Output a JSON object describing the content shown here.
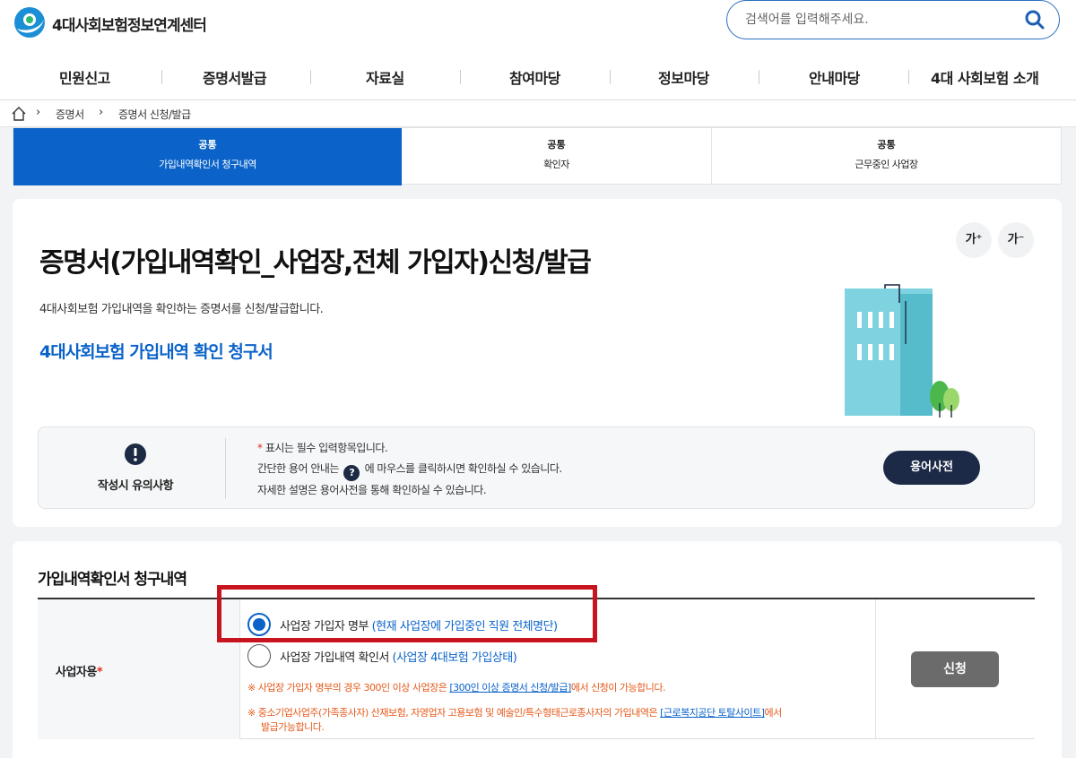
{
  "header": {
    "logo_text": "4대사회보험정보연계센터",
    "search_placeholder": "검색어를 입력해주세요."
  },
  "gnb": [
    "민원신고",
    "증명서발급",
    "자료실",
    "참여마당",
    "정보마당",
    "안내마당",
    "4대 사회보험 소개"
  ],
  "breadcrumb": [
    "증명서",
    "증명서 신청/발급"
  ],
  "tabs": [
    {
      "top": "공통",
      "label": "가입내역확인서 청구내역",
      "active": true
    },
    {
      "top": "공통",
      "label": "확인자",
      "active": false
    },
    {
      "top": "공통",
      "label": "근무중인 사업장",
      "active": false
    }
  ],
  "font_buttons": {
    "increase": "가⁺",
    "decrease": "가⁻"
  },
  "page": {
    "title": "증명서(가입내역확인_사업장,전체 가입자)신청/발급",
    "description": "4대사회보험 가입내역을 확인하는 증명서를 신청/발급합니다.",
    "subtitle": "4대사회보험 가입내역 확인 청구서"
  },
  "notice": {
    "label": "작성시 유의사항",
    "line1_star": "*",
    "line1": " 표시는 필수 입력항목입니다.",
    "line2_pre": "간단한 용어 안내는 ",
    "line2_icon": "?",
    "line2_post": " 에 마우스를 클릭하시면 확인하실 수 있습니다.",
    "line3": "자세한 설명은 용어사전을 통해 확인하실 수 있습니다.",
    "dict_button": "용어사전"
  },
  "section": {
    "title": "가입내역확인서 청구내역",
    "field_label": "사업자용",
    "field_required": "*",
    "options": [
      {
        "label": "사업장 가입자 명부",
        "extra": "(현재 사업장에 가입중인 직원 전체명단)",
        "selected": true
      },
      {
        "label": "사업장 가입내역 확인서",
        "extra": "(사업장 4대보험 가입상태)",
        "selected": false
      }
    ],
    "note1_pre": "※ 사업장 가입자 명부의 경우 300인 이상 사업장은 ",
    "note1_link": "[300인 이상 증명서 신청/발급]",
    "note1_post": "에서 신청이 가능합니다.",
    "note2_pre": "※ 중소기업사업주(가족종사자) 산재보험, 자영업자 고용보험 및 예술인/특수형태근로종사자의 가입내역은 ",
    "note2_link": "[근로복지공단 토탈사이트]",
    "note2_post": "에서",
    "note2_line2": "발급가능합니다.",
    "apply_button": "신청"
  },
  "colors": {
    "primary": "#0b63c9",
    "highlight_box": "#c8141e",
    "note": "#e5591a"
  }
}
